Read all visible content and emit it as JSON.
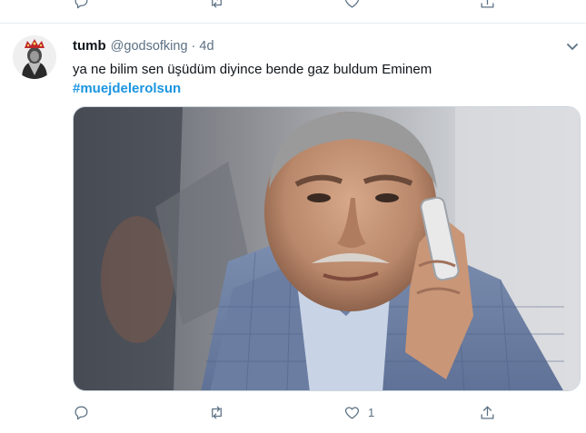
{
  "prev_tweet_actions": {
    "reply_icon": "reply-icon",
    "retweet_icon": "retweet-icon",
    "like_icon": "heart-icon",
    "share_icon": "share-icon"
  },
  "tweet": {
    "display_name": "tumb",
    "handle": "@godsofking",
    "separator": "·",
    "time": "4d",
    "text": "ya ne bilim sen üşüdüm diyince bende gaz buldum Eminem",
    "hashtag": "#muejdelerolsun",
    "like_count": "1",
    "colors": {
      "hashtag": "#1b95e0",
      "secondary": "#5b7083",
      "divider": "#e6ecf0"
    }
  }
}
